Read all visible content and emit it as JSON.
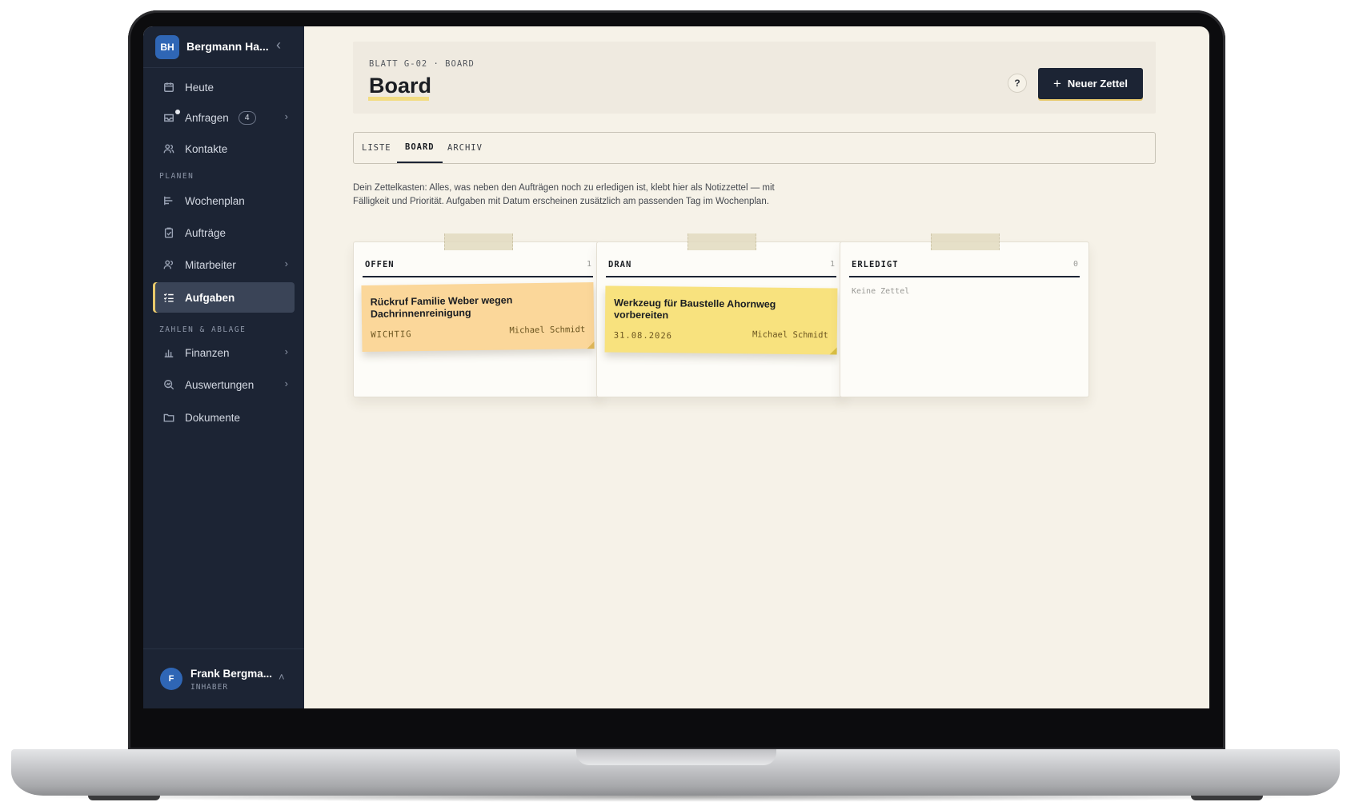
{
  "org": {
    "initials": "BH",
    "name": "Bergmann Ha..."
  },
  "nav": {
    "heute": "Heute",
    "anfragen": "Anfragen",
    "anfragen_count": "4",
    "kontakte": "Kontakte",
    "section_planen": "PLANEN",
    "wochenplan": "Wochenplan",
    "auftraege": "Aufträge",
    "mitarbeiter": "Mitarbeiter",
    "aufgaben": "Aufgaben",
    "section_zahlen": "ZAHLEN & ABLAGE",
    "finanzen": "Finanzen",
    "auswertungen": "Auswertungen",
    "dokumente": "Dokumente"
  },
  "user": {
    "initial": "F",
    "name": "Frank Bergma...",
    "role": "INHABER"
  },
  "header": {
    "breadcrumb": "BLATT G-02 · BOARD",
    "title": "Board",
    "help": "?",
    "new_button": "Neuer Zettel"
  },
  "tabs": [
    "LISTE",
    "BOARD",
    "ARCHIV"
  ],
  "active_tab": "BOARD",
  "intro": "Dein Zettelkasten: Alles, was neben den Aufträgen noch zu erledigen ist, klebt hier als Notizzettel — mit Fälligkeit und Priorität. Aufgaben mit Datum erscheinen zusätzlich am passenden Tag im Wochenplan.",
  "columns": [
    {
      "title": "OFFEN",
      "count": "1",
      "notes": [
        {
          "title": "Rückruf Familie Weber wegen Dachrinnenreinigung",
          "meta": "WICHTIG",
          "assignee": "Michael Schmidt",
          "color": "#fbd79a"
        }
      ]
    },
    {
      "title": "DRAN",
      "count": "1",
      "notes": [
        {
          "title": "Werkzeug für Baustelle Ahornweg vorbereiten",
          "meta": "31.08.2026",
          "assignee": "Michael Schmidt",
          "color": "#f8e27e"
        }
      ]
    },
    {
      "title": "ERLEDIGT",
      "count": "0",
      "empty_text": "Keine Zettel"
    }
  ],
  "colors": {
    "sidebar": "#1c2434",
    "accent": "#e8c96b",
    "background": "#f6f2e8"
  }
}
